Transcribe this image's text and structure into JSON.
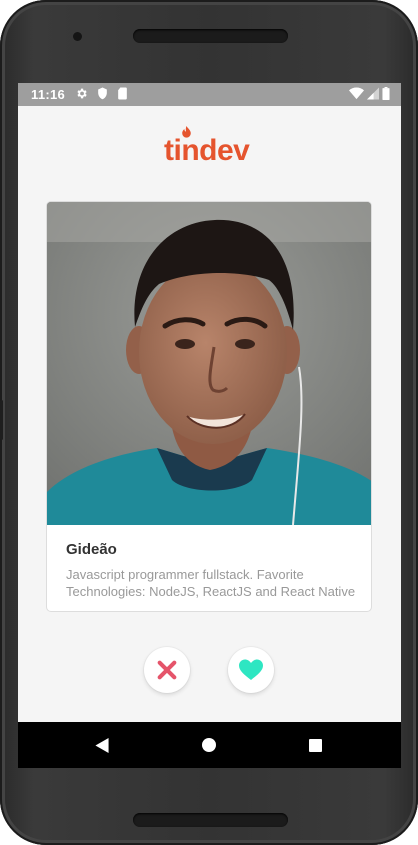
{
  "status_bar": {
    "time": "11:16",
    "left_icons": [
      "gear-icon",
      "shield-icon",
      "sd-card-icon"
    ],
    "right_icons": [
      "wifi-icon",
      "signal-icon",
      "battery-icon"
    ]
  },
  "app": {
    "logo_text": "tindev",
    "brand_color": "#e5542e"
  },
  "profile": {
    "name": "Gideão",
    "bio": "Javascript programmer fullstack. Favorite Technologies: NodeJS, ReactJS and React Native",
    "avatar_icon": "profile-photo"
  },
  "actions": {
    "dislike_icon": "close-icon",
    "like_icon": "heart-icon",
    "dislike_color": "#e5546a",
    "like_color": "#2ee6c2"
  },
  "nav_bar": {
    "icons": [
      "back-icon",
      "home-icon",
      "recents-icon"
    ]
  }
}
